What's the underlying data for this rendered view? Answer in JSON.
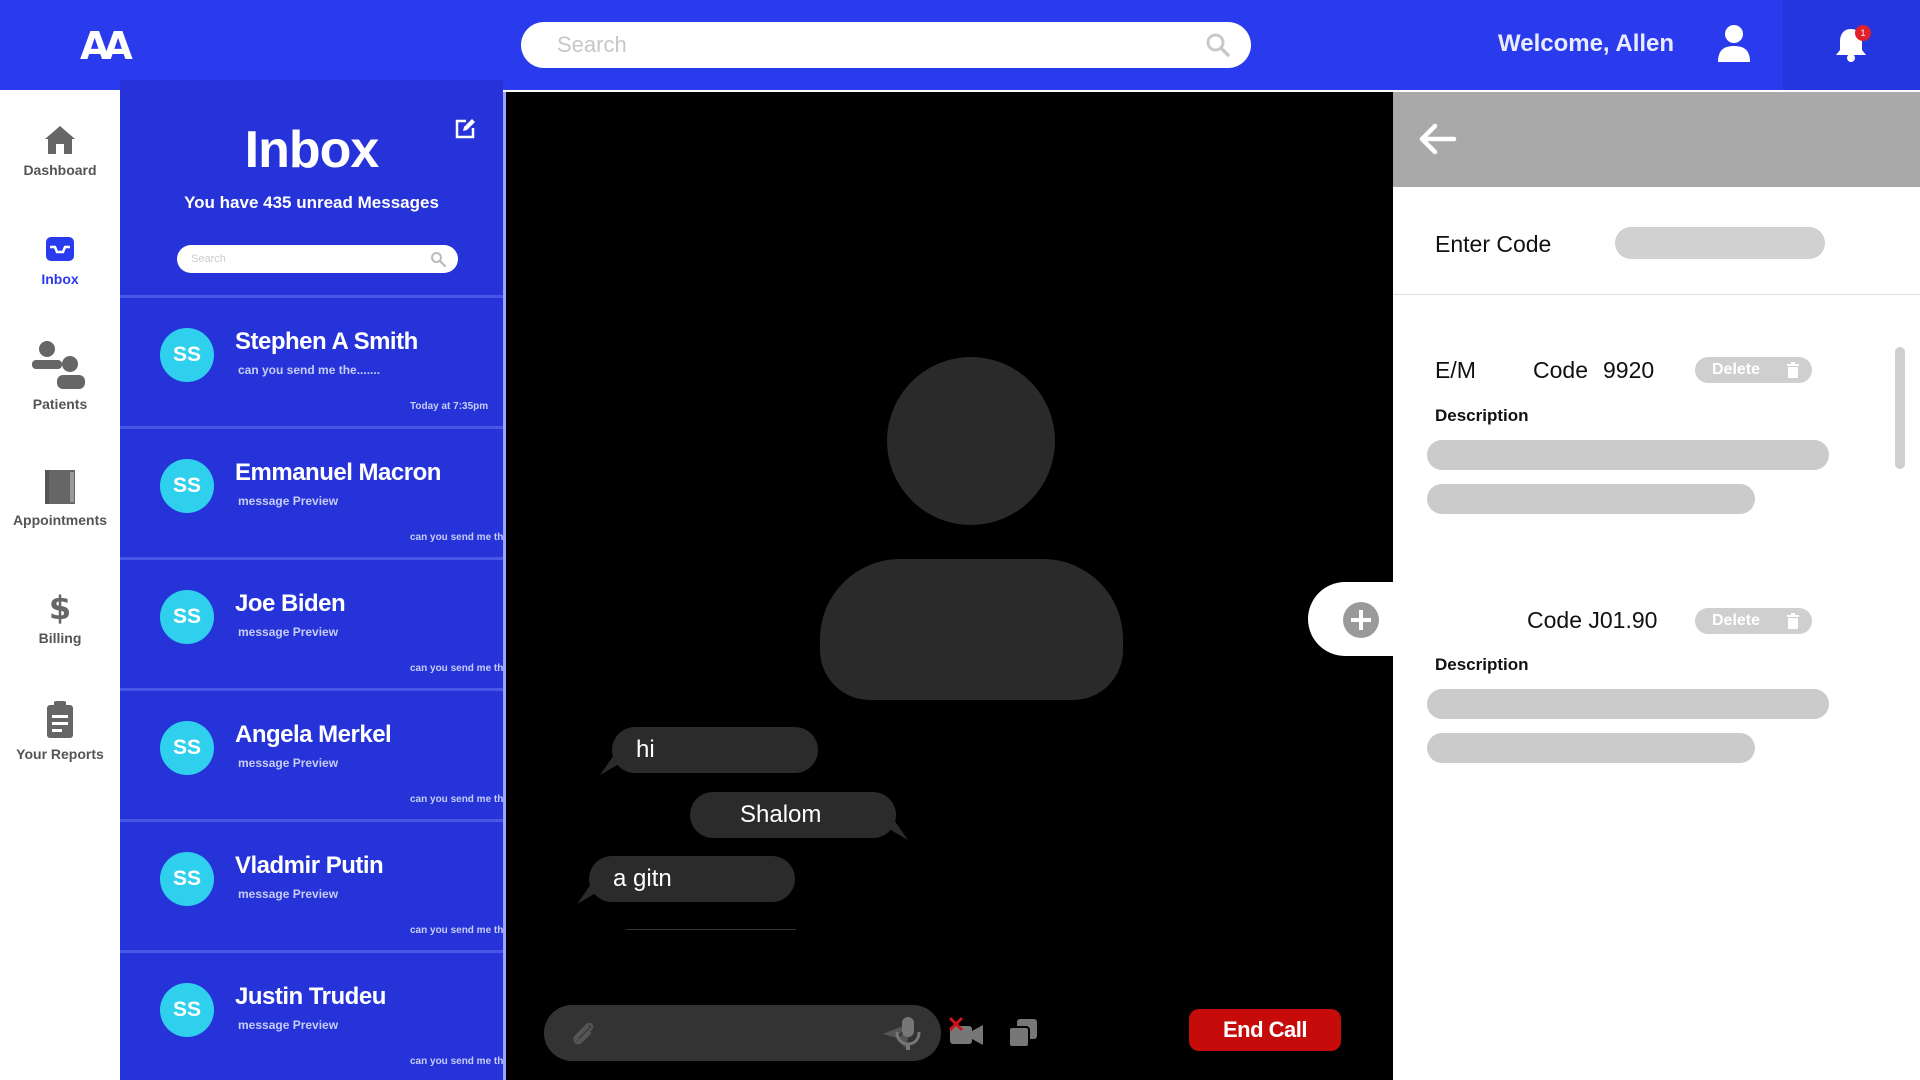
{
  "header": {
    "logo": "AA",
    "search_placeholder": "Search",
    "welcome": "Welcome, Allen",
    "notification_count": "1"
  },
  "nav": {
    "items": [
      {
        "label": "Dashboard",
        "icon": "home-icon"
      },
      {
        "label": "Inbox",
        "icon": "inbox-icon",
        "active": true
      },
      {
        "label": "Patients",
        "icon": "users-icon"
      },
      {
        "label": "Appointments",
        "icon": "book-icon"
      },
      {
        "label": "Billing",
        "icon": "dollar-icon"
      },
      {
        "label": "Your Reports",
        "icon": "clipboard-icon"
      }
    ]
  },
  "inbox": {
    "title": "Inbox",
    "subtitle": "You have 435 unread Messages",
    "search_placeholder": "Search",
    "messages": [
      {
        "initials": "SS",
        "name": "Stephen A Smith",
        "preview": "can you send me the.......",
        "time": "Today at 7:35pm"
      },
      {
        "initials": "SS",
        "name": "Emmanuel Macron",
        "preview": "message Preview",
        "time": "can you send me th"
      },
      {
        "initials": "SS",
        "name": "Joe Biden",
        "preview": "message Preview",
        "time": "can you send me th"
      },
      {
        "initials": "SS",
        "name": "Angela Merkel",
        "preview": "message Preview",
        "time": "can you send me th"
      },
      {
        "initials": "SS",
        "name": "Vladmir Putin",
        "preview": "message Preview",
        "time": "can you send me th"
      },
      {
        "initials": "SS",
        "name": "Justin Trudeu",
        "preview": "message Preview",
        "time": "can you send me th"
      }
    ]
  },
  "call": {
    "chat": [
      "hi",
      "Shalom",
      "a gitn"
    ],
    "end_call": "End Call"
  },
  "codes": {
    "enter_code_label": "Enter Code",
    "entry1": {
      "type": "E/M",
      "code_label": "Code",
      "code_value": "9920",
      "delete": "Delete",
      "description_label": "Description"
    },
    "entry2": {
      "code_label": "Code J01.90",
      "delete": "Delete",
      "description_label": "Description"
    }
  },
  "colors": {
    "header_blue": "#2a3bee",
    "inbox_blue": "#2533d8",
    "avatar_cyan": "#2fd0ee",
    "end_call_red": "#c60b0b"
  }
}
